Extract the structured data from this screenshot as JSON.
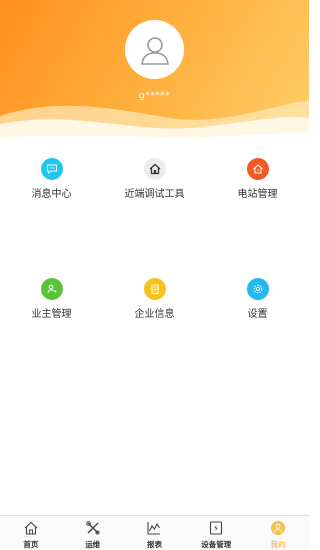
{
  "profile": {
    "username": "g*****",
    "avatar_icon": "user-avatar-icon"
  },
  "colors": {
    "header_start": "#ff8f1e",
    "header_end": "#ffce6a",
    "message_icon": "#1ec6ee",
    "tool_icon": "#e0e0e0",
    "station_icon": "#f25a23",
    "owner_icon": "#58c43a",
    "company_icon": "#f7c21b",
    "settings_icon": "#22b8f0",
    "active_tab": "#f5a623"
  },
  "menu": [
    {
      "label": "消息中心",
      "icon": "message-icon"
    },
    {
      "label": "近端调试工具",
      "icon": "home-tool-icon"
    },
    {
      "label": "电站管理",
      "icon": "power-station-icon"
    },
    {
      "label": "业主管理",
      "icon": "owner-icon"
    },
    {
      "label": "企业信息",
      "icon": "company-icon"
    },
    {
      "label": "设置",
      "icon": "settings-icon"
    }
  ],
  "tabs": [
    {
      "label": "首页",
      "icon": "home-icon"
    },
    {
      "label": "运维",
      "icon": "maintenance-icon"
    },
    {
      "label": "报表",
      "icon": "report-icon"
    },
    {
      "label": "设备管理",
      "icon": "device-icon"
    },
    {
      "label": "我的",
      "icon": "profile-icon",
      "active": true
    }
  ]
}
